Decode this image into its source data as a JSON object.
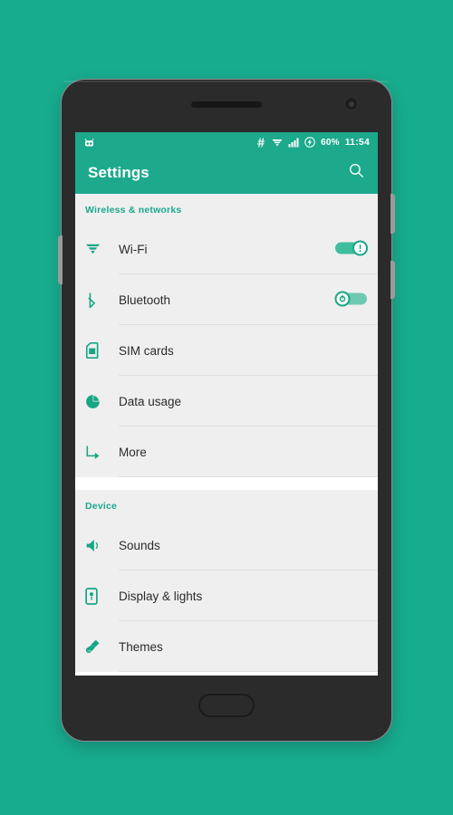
{
  "theme": {
    "background": "#18AC8E",
    "accent": "#1CA98C",
    "appbar": "#1CA98C",
    "paw": "#7DC9BC",
    "list_bg": "#efefef",
    "text": "#2b2b2b"
  },
  "device": {
    "name": "android-phone-mockup",
    "buttons": {
      "volume": "volume-rocker",
      "power": "power-button",
      "sim": "sim-tray",
      "home": "home-button"
    },
    "hardware": {
      "earpiece": "earpiece-speaker",
      "camera": "front-camera"
    }
  },
  "status_bar": {
    "notification_icon": "robot-face-icon",
    "icons": [
      "hash-icon",
      "wifi-icon",
      "signal-bars-icon",
      "battery-charge-icon"
    ],
    "battery_percent": "60%",
    "clock": "11:54"
  },
  "app_bar": {
    "title": "Settings",
    "search_icon": "search-icon"
  },
  "sections": [
    {
      "header": "Wireless & networks",
      "rows": [
        {
          "label": "Wi-Fi",
          "icon": "wifi-icon",
          "toggle": "on"
        },
        {
          "label": "Bluetooth",
          "icon": "bluetooth-icon",
          "toggle": "off"
        },
        {
          "label": "SIM cards",
          "icon": "sim-card-icon",
          "toggle": null
        },
        {
          "label": "Data usage",
          "icon": "pie-chart-icon",
          "toggle": null
        },
        {
          "label": "More",
          "icon": "arrow-more-icon",
          "toggle": null
        }
      ]
    },
    {
      "header": "Device",
      "rows": [
        {
          "label": "Sounds",
          "icon": "speaker-icon",
          "toggle": null
        },
        {
          "label": "Display & lights",
          "icon": "display-icon",
          "toggle": null
        },
        {
          "label": "Themes",
          "icon": "paintbrush-icon",
          "toggle": null
        }
      ]
    }
  ]
}
